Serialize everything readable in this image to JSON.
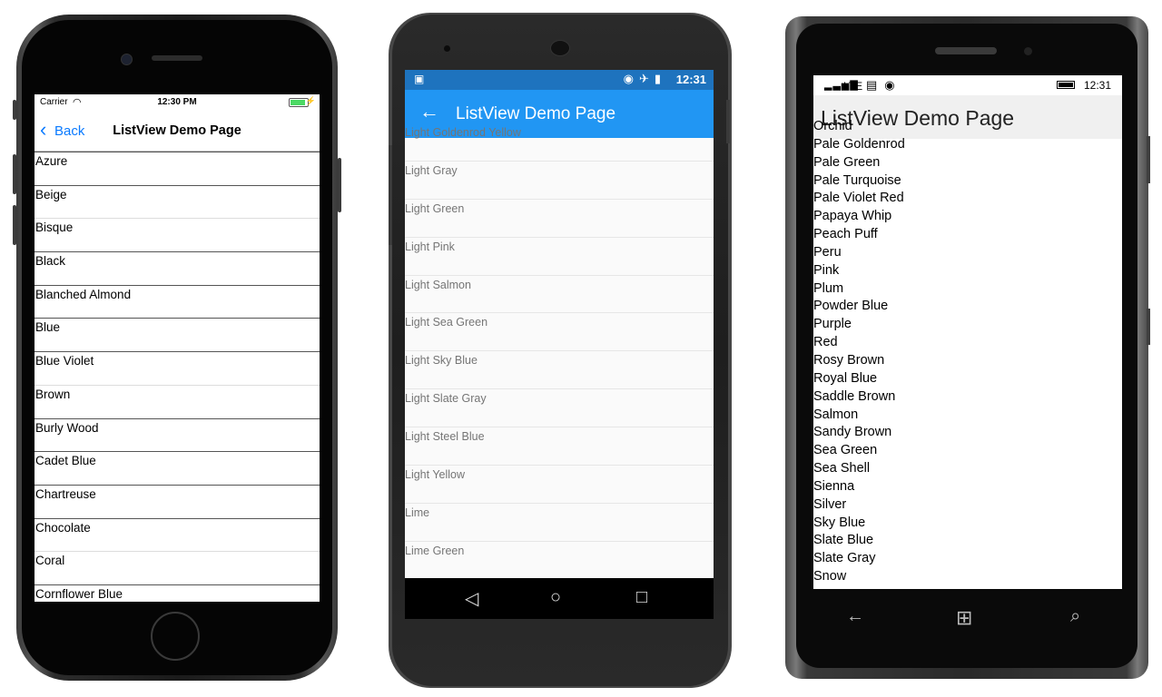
{
  "ios": {
    "status": {
      "carrier": "Carrier",
      "time": "12:30 PM"
    },
    "nav": {
      "back_label": "Back",
      "title": "ListView Demo Page"
    },
    "items": [
      "Azure",
      "Beige",
      "Bisque",
      "Black",
      "Blanched Almond",
      "Blue",
      "Blue Violet",
      "Brown",
      "Burly Wood",
      "Cadet Blue",
      "Chartreuse",
      "Chocolate",
      "Coral",
      "Cornflower Blue"
    ],
    "accent": "#0a7aff"
  },
  "android": {
    "status": {
      "time": "12:31"
    },
    "toolbar": {
      "title": "ListView Demo Page"
    },
    "items": [
      "Light Goldenrod Yellow",
      "Light Gray",
      "Light Green",
      "Light Pink",
      "Light Salmon",
      "Light Sea Green",
      "Light Sky Blue",
      "Light Slate Gray",
      "Light Steel Blue",
      "Light Yellow",
      "Lime",
      "Lime Green"
    ],
    "accent": "#2196f3"
  },
  "winphone": {
    "status": {
      "network": "LTE",
      "time": "12:31"
    },
    "header": {
      "title": "ListView Demo Page"
    },
    "items": [
      "Orchid",
      "Pale Goldenrod",
      "Pale Green",
      "Pale Turquoise",
      "Pale Violet Red",
      "Papaya Whip",
      "Peach Puff",
      "Peru",
      "Pink",
      "Plum",
      "Powder Blue",
      "Purple",
      "Red",
      "Rosy Brown",
      "Royal Blue",
      "Saddle Brown",
      "Salmon",
      "Sandy Brown",
      "Sea Green",
      "Sea Shell",
      "Sienna",
      "Silver",
      "Sky Blue",
      "Slate Blue",
      "Slate Gray",
      "Snow"
    ]
  }
}
